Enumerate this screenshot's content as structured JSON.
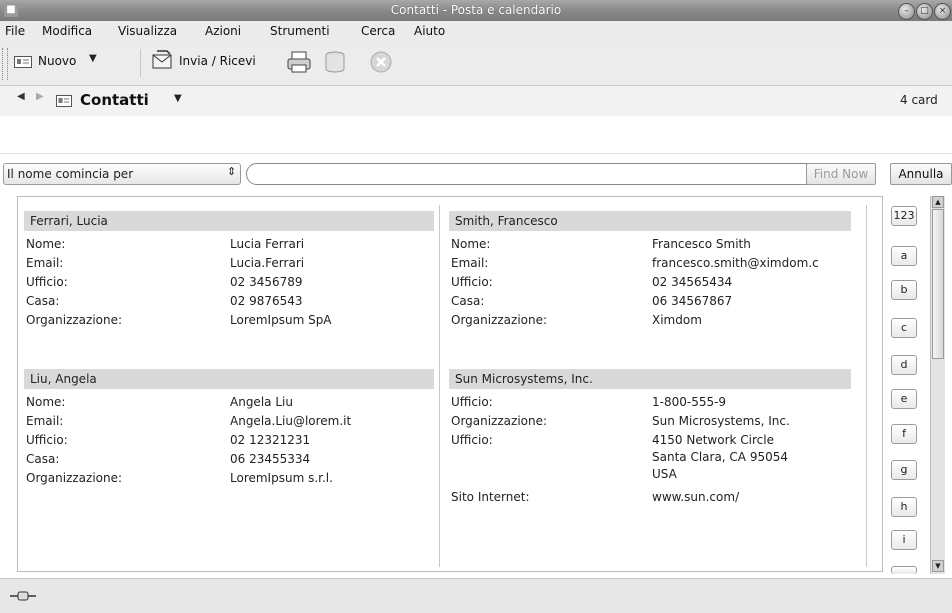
{
  "window": {
    "title": "Contatti - Posta e calendario"
  },
  "menubar": [
    "File",
    "Modifica",
    "Visualizza",
    "Azioni",
    "Strumenti",
    "Cerca",
    "Aiuto"
  ],
  "toolbar": {
    "new_label": "Nuovo",
    "send_receive_label": "Invia / Ricevi"
  },
  "folder": {
    "name": "Contatti",
    "count": "4 card"
  },
  "search": {
    "criteria": "Il nome comincia per",
    "find_label": "Find Now",
    "cancel_label": "Annulla"
  },
  "contacts": [
    {
      "heading": "Ferrari, Lucia",
      "fields": [
        {
          "label": "Nome:",
          "value": "Lucia Ferrari"
        },
        {
          "label": "Email:",
          "value": "Lucia.Ferrari"
        },
        {
          "label": "Ufficio:",
          "value": "02 3456789"
        },
        {
          "label": "Casa:",
          "value": "02 9876543"
        },
        {
          "label": "Organizzazione:",
          "value": "LoremIpsum SpA"
        }
      ]
    },
    {
      "heading": "Liu, Angela",
      "fields": [
        {
          "label": "Nome:",
          "value": "Angela Liu"
        },
        {
          "label": "Email:",
          "value": "Angela.Liu@lorem.it"
        },
        {
          "label": "Ufficio:",
          "value": "02 12321231"
        },
        {
          "label": "Casa:",
          "value": "06 23455334"
        },
        {
          "label": "Organizzazione:",
          "value": "LoremIpsum s.r.l."
        }
      ]
    },
    {
      "heading": "Smith, Francesco",
      "fields": [
        {
          "label": "Nome:",
          "value": "Francesco Smith"
        },
        {
          "label": "Email:",
          "value": "francesco.smith@ximdom.c"
        },
        {
          "label": "Ufficio:",
          "value": "02 34565434"
        },
        {
          "label": "Casa:",
          "value": "06 34567867"
        },
        {
          "label": "Organizzazione:",
          "value": "Ximdom"
        }
      ]
    },
    {
      "heading": "Sun Microsystems, Inc.",
      "fields": [
        {
          "label": "Ufficio:",
          "value": "1-800-555-9"
        },
        {
          "label": "Organizzazione:",
          "value": "Sun Microsystems, Inc."
        },
        {
          "label": "Ufficio:",
          "value": "4150 Network Circle"
        },
        {
          "label": "",
          "value": "Santa Clara, CA 95054"
        },
        {
          "label": "",
          "value": "USA"
        },
        {
          "label": "Sito Internet:",
          "value": "www.sun.com/"
        }
      ]
    }
  ],
  "index": [
    "123",
    "a",
    "b",
    "c",
    "d",
    "e",
    "f",
    "g",
    "h",
    "i"
  ],
  "colors": {
    "card_header": "#d9d9d9",
    "titlebar": "#8a8a8a"
  }
}
